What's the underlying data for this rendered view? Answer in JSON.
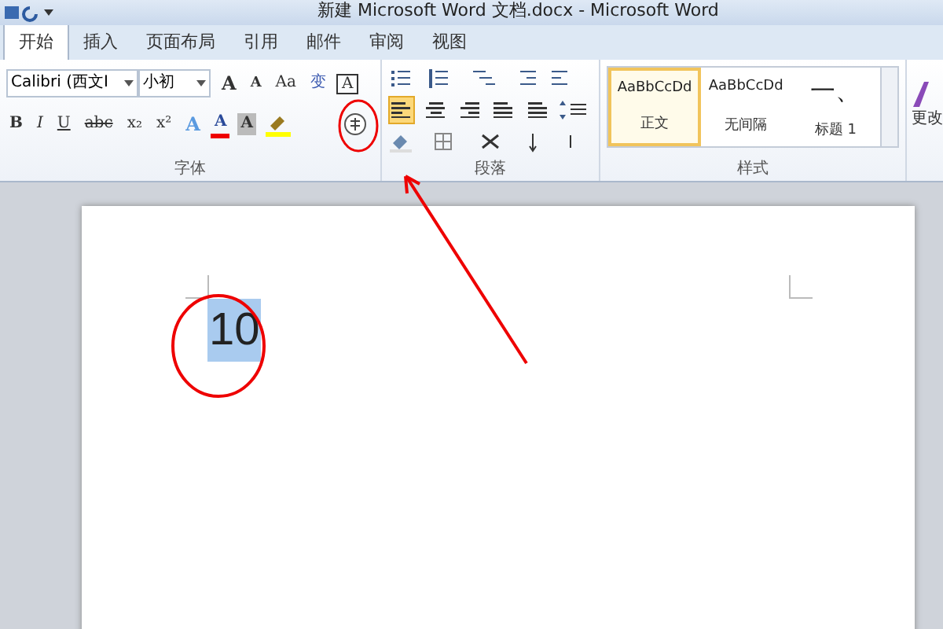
{
  "window": {
    "title": "新建 Microsoft Word 文档.docx - Microsoft Word"
  },
  "tabs": [
    {
      "label": "开始",
      "selected": true
    },
    {
      "label": "插入",
      "selected": false
    },
    {
      "label": "页面布局",
      "selected": false
    },
    {
      "label": "引用",
      "selected": false
    },
    {
      "label": "邮件",
      "selected": false
    },
    {
      "label": "审阅",
      "selected": false
    },
    {
      "label": "视图",
      "selected": false
    }
  ],
  "font_group": {
    "label": "字体",
    "font": "Calibri (西文Ⅰ",
    "size": "小初",
    "row1": [
      {
        "kind": "grow",
        "label": "A"
      },
      {
        "kind": "shrink",
        "label": "A"
      },
      {
        "kind": "case",
        "label": "Aa"
      },
      {
        "kind": "plain",
        "label": "变"
      },
      {
        "kind": "boxed",
        "label": "A"
      }
    ],
    "row2": [
      {
        "kind": "bold",
        "label": "B"
      },
      {
        "kind": "italic",
        "label": "I"
      },
      {
        "kind": "underline",
        "label": "U"
      },
      {
        "kind": "strike",
        "label": "abc"
      },
      {
        "kind": "sub",
        "label": "x₂"
      },
      {
        "kind": "sup",
        "label": "x²"
      },
      {
        "kind": "effect",
        "label": "A"
      },
      {
        "kind": "color",
        "label": "A"
      },
      {
        "kind": "shade",
        "label": "A"
      }
    ]
  },
  "paragraph_group": {
    "label": "段落",
    "align": [
      {
        "kind": "left",
        "selected": true
      },
      {
        "kind": "center",
        "selected": false
      },
      {
        "kind": "right",
        "selected": false
      },
      {
        "kind": "justify",
        "selected": false
      },
      {
        "kind": "distribute",
        "selected": false
      }
    ]
  },
  "styles_group": {
    "label": "样式",
    "items": [
      {
        "preview": "AaBbCcDd",
        "name": "正文",
        "selected": true
      },
      {
        "preview": "AaBbCcDd",
        "name": "无间隔",
        "selected": false
      },
      {
        "preview": "一、",
        "name": "标题 1",
        "selected": false
      }
    ],
    "change": "更改"
  },
  "document": {
    "text": "10",
    "selected": true
  }
}
